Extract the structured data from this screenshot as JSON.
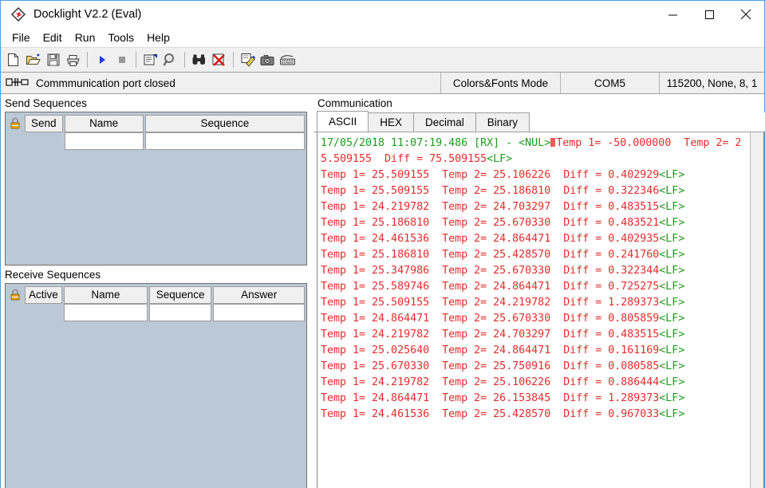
{
  "window": {
    "title": "Docklight V2.2 (Eval)",
    "icon": "docklight-logo-icon",
    "controls": [
      {
        "name": "minimize-button",
        "glyph": "minimize-icon"
      },
      {
        "name": "maximize-button",
        "glyph": "maximize-icon"
      },
      {
        "name": "close-button",
        "glyph": "close-icon"
      }
    ]
  },
  "menu": {
    "items": [
      {
        "label": "File",
        "name": "menu-file"
      },
      {
        "label": "Edit",
        "name": "menu-edit"
      },
      {
        "label": "Run",
        "name": "menu-run"
      },
      {
        "label": "Tools",
        "name": "menu-tools"
      },
      {
        "label": "Help",
        "name": "menu-help"
      }
    ]
  },
  "toolbar": {
    "buttons": [
      {
        "name": "new-file-icon",
        "tip": "New"
      },
      {
        "name": "open-folder-icon",
        "tip": "Open"
      },
      {
        "name": "save-disk-icon",
        "tip": "Save"
      },
      {
        "name": "print-icon",
        "tip": "Print"
      },
      {
        "name": "start-communication-icon",
        "tip": "Start"
      },
      {
        "name": "stop-communication-icon",
        "tip": "Stop"
      },
      {
        "name": "project-settings-icon",
        "tip": "Project Settings"
      },
      {
        "name": "search-magnifier-icon",
        "tip": "Find"
      },
      {
        "name": "binoculars-icon",
        "tip": "Find Next"
      },
      {
        "name": "clear-communication-icon",
        "tip": "Clear"
      },
      {
        "name": "edit-comment-icon",
        "tip": "Comment"
      },
      {
        "name": "camera-snapshot-icon",
        "tip": "Snapshot"
      },
      {
        "name": "keyboard-console-icon",
        "tip": "Keyboard Console"
      }
    ]
  },
  "statusbar": {
    "port_icon": "serial-port-icon",
    "port_status": "Commmunication port closed",
    "colors_fonts_mode": "Colors&Fonts Mode",
    "com_port": "COM5",
    "settings": "115200, None, 8, 1"
  },
  "send_sequences": {
    "label": "Send Sequences",
    "lock_icon": "lock-icon",
    "columns": [
      "Send",
      "Name",
      "Sequence"
    ],
    "rows": [
      {
        "send": "",
        "name": "",
        "sequence": ""
      }
    ]
  },
  "receive_sequences": {
    "label": "Receive Sequences",
    "lock_icon": "lock-icon",
    "columns": [
      "Active",
      "Name",
      "Sequence",
      "Answer"
    ],
    "rows": [
      {
        "active": "",
        "name": "",
        "sequence": "",
        "answer": ""
      }
    ]
  },
  "communication": {
    "label": "Communication",
    "tabs": [
      {
        "label": "ASCII",
        "name": "tab-ascii",
        "active": true
      },
      {
        "label": "HEX",
        "name": "tab-hex",
        "active": false
      },
      {
        "label": "Decimal",
        "name": "tab-decimal",
        "active": false
      },
      {
        "label": "Binary",
        "name": "tab-binary",
        "active": false
      }
    ],
    "log": {
      "header": {
        "timestamp": "17/05/2018 11:07:19.486",
        "direction": "[RX]",
        "dash": "-",
        "nul": "<NUL>",
        "payload": "Temp 1= -50.000000  Temp 2= 25.509155  Diff = 75.509155",
        "terminator": "<LF>"
      },
      "lines": [
        {
          "text": "Temp 1= 25.509155  Temp 2= 25.106226  Diff = 0.402929",
          "terminator": "<LF>"
        },
        {
          "text": "Temp 1= 25.509155  Temp 2= 25.186810  Diff = 0.322346",
          "terminator": "<LF>"
        },
        {
          "text": "Temp 1= 24.219782  Temp 2= 24.703297  Diff = 0.483515",
          "terminator": "<LF>"
        },
        {
          "text": "Temp 1= 25.186810  Temp 2= 25.670330  Diff = 0.483521",
          "terminator": "<LF>"
        },
        {
          "text": "Temp 1= 24.461536  Temp 2= 24.864471  Diff = 0.402935",
          "terminator": "<LF>"
        },
        {
          "text": "Temp 1= 25.186810  Temp 2= 25.428570  Diff = 0.241760",
          "terminator": "<LF>"
        },
        {
          "text": "Temp 1= 25.347986  Temp 2= 25.670330  Diff = 0.322344",
          "terminator": "<LF>"
        },
        {
          "text": "Temp 1= 25.589746  Temp 2= 24.864471  Diff = 0.725275",
          "terminator": "<LF>"
        },
        {
          "text": "Temp 1= 25.509155  Temp 2= 24.219782  Diff = 1.289373",
          "terminator": "<LF>"
        },
        {
          "text": "Temp 1= 24.864471  Temp 2= 25.670330  Diff = 0.805859",
          "terminator": "<LF>"
        },
        {
          "text": "Temp 1= 24.219782  Temp 2= 24.703297  Diff = 0.483515",
          "terminator": "<LF>"
        },
        {
          "text": "Temp 1= 25.025640  Temp 2= 24.864471  Diff = 0.161169",
          "terminator": "<LF>"
        },
        {
          "text": "Temp 1= 25.670330  Temp 2= 25.750916  Diff = 0.080585",
          "terminator": "<LF>"
        },
        {
          "text": "Temp 1= 24.219782  Temp 2= 25.106226  Diff = 0.886444",
          "terminator": "<LF>"
        },
        {
          "text": "Temp 1= 24.864471  Temp 2= 26.153845  Diff = 1.289373",
          "terminator": "<LF>"
        },
        {
          "text": "Temp 1= 24.461536  Temp 2= 25.428570  Diff = 0.967033",
          "terminator": "<LF>"
        }
      ]
    }
  },
  "colors": {
    "rx_text": "#e52b2b",
    "meta_text": "#1a9c1a",
    "panel_bg": "#bbc8d6",
    "toolbar_bg": "#f0f0f0",
    "window_border": "#4a9fe0"
  }
}
